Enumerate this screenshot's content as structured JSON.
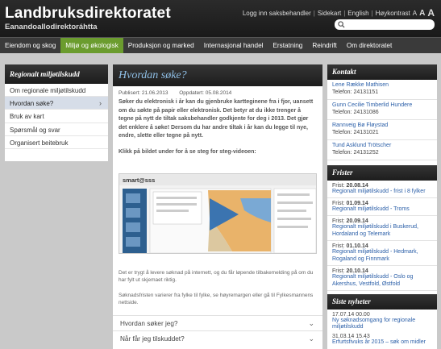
{
  "header": {
    "title": "Landbruksdirektoratet",
    "subtitle": "Eanandoallodirektoráhtta",
    "util_links": [
      "Logg inn saksbehandler",
      "Sidekart",
      "English",
      "Høykontrast"
    ],
    "font_sizes": [
      "A",
      "A",
      "A"
    ],
    "search": {
      "placeholder": ""
    }
  },
  "nav": [
    "Eiendom og skog",
    "Miljø og økologisk",
    "Produksjon og marked",
    "Internasjonal handel",
    "Erstatning",
    "Reindrift",
    "Om direktoratet"
  ],
  "nav_active": 1,
  "left": {
    "heading": "Regionalt miljøtilskudd",
    "items": [
      "Om regionale miljøtilskudd",
      "Hvordan søke?",
      "Bruk av kart",
      "Spørsmål og svar",
      "Organisert beitebruk"
    ],
    "active": 1
  },
  "main": {
    "heading": "Hvordan søke?",
    "published": "Publisert: 21.06.2013",
    "updated": "Oppdatert: 05.08.2014",
    "lead": "Søker du elektronisk i år kan du gjenbruke kartteginene fra i fjor, uansett om du søkte på papir eller elektronisk. Det betyr at du ikke trenger å tegne på nytt de tiltak saksbehandler godkjente for deg i 2013. Det gjør det enklere å søke! Dersom du har andre tiltak i år kan du legge til nye, endre, slette eller tegne på nytt.",
    "video_caption": "Klikk på bildet under for å se steg for steg-videoen:",
    "video_brand": "smart@sss",
    "body1": "Det er trygt å levere søknad på internett, og du får løpende tilbakemelding på om du har fylt ut skjemaet riktig.",
    "body2": "Søknadsfristen varierer fra fylke til fylke, se høyremargen eller gå til Fylkesmannens nettside.",
    "faq": [
      "Hvordan søker jeg?",
      "Når får jeg tilskuddet?"
    ]
  },
  "right": {
    "contact_heading": "Kontakt",
    "contacts": [
      {
        "name": "Lene Række Mathisen",
        "phone": "Telefon: 24131151"
      },
      {
        "name": "Gunn Cecilie Timberlid Hundere",
        "phone": "Telefon: 24131086"
      },
      {
        "name": "Rannveig Bø Fløystad",
        "phone": "Telefon: 24131021"
      },
      {
        "name": "Tund Asklund Trötscher",
        "phone": "Telefon: 24131252"
      }
    ],
    "frister_heading": "Frister",
    "frister": [
      {
        "label": "Frist:",
        "date": "20.08.14",
        "link": "Regionalt miljøtilskudd - frist i 8 fylker"
      },
      {
        "label": "Frist:",
        "date": "01.09.14",
        "link": "Regionalt miljøtilskudd - Troms"
      },
      {
        "label": "Frist:",
        "date": "20.09.14",
        "link": "Regionalt miljøtilskudd i Buskerud, Hordaland og Telemark"
      },
      {
        "label": "Frist:",
        "date": "01.10.14",
        "link": "Regionalt miljøtilskudd - Hedmark, Rogaland og Finnmark"
      },
      {
        "label": "Frist:",
        "date": "20.10.14",
        "link": "Regionalt miljøtilskudd - Oslo og Akershus, Vestfold, Østfold"
      }
    ],
    "news_heading": "Siste nyheter",
    "news": [
      {
        "date": "17.07.14 00.00",
        "link": "Ny søknadsomgang for regionale miljøtilskudd"
      },
      {
        "date": "31.03.14 15.43",
        "link": "Erfurtsfivuks år 2015 – søk om midler"
      }
    ]
  },
  "colors": {
    "nav_active": "#6b9c2e",
    "link": "#2b5fa8",
    "heading_blue": "#8fbfe6"
  },
  "icons": [
    "search-icon",
    "play-icon",
    "chevron-right-icon",
    "chevron-down-icon"
  ]
}
